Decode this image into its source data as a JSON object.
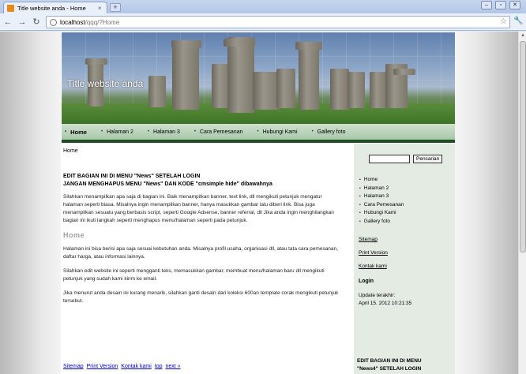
{
  "browser": {
    "tab_title": "Title website anda - Home",
    "tab_close": "×",
    "new_tab": "+",
    "url_host": "localhost",
    "url_path": "/qqq/?Home",
    "window_controls": [
      "–",
      "▫",
      "✕"
    ]
  },
  "site": {
    "title": "Title website anda",
    "nav": [
      "Home",
      "Halaman 2",
      "Halaman 3",
      "Cara Pemesanan",
      "Hubungi Kami",
      "Gallery foto"
    ]
  },
  "main": {
    "breadcrumb": "Home",
    "notice_line1": "EDIT BAGIAN INI DI MENU \"News\" SETELAH LOGIN",
    "notice_line2": "JANGAN MENGHAPUS MENU \"News\" DAN KODE \"cmsimple hide\" dibawahnya",
    "para1": "Silahkan menampilkan apa saja di bagian ini. Baik menampilkan banner, text link, dll mengikuti petunjuk mengatur halaman seperti biasa. Misalnya ingin menampilkan banner, hanya masukkan gambar lalu diberi link. Bisa juga menampilkan sesuatu yang berbasis script, seperti Google Adsense, banner referral, dll Jika anda ingin menghilangkan bagian ini ikuti langkah seperti menghapus menu/halaman seperti pada petunjuk.",
    "home_heading": "Home",
    "para2": "Halaman ini bisa berisi apa saja sesuai kebutuhan anda. Misalnya profil usaha, organisasi dll, atau tata cara pemesanan, daftar harga, atau informasi lainnya.",
    "para3": "Silahkan edit website ini seperti mengganti teks, memasukkan gambar, membuat menu/halaman baru dll mengikuti petunjuk yang sudah kami kirim ke email.",
    "para4": "Jika menurut anda desain ini kurang menarik, silahkan ganti desain dari koleksi 600an template corak mengikuti petunjuk tersebut.",
    "footer_links": [
      "Sitemap",
      "Print Version",
      "Kontak kami",
      "top",
      "next »"
    ]
  },
  "sidebar": {
    "search_button": "Pencarian",
    "search_value": "",
    "menu": [
      "Home",
      "Halaman 2",
      "Halaman 3",
      "Cara Pemesanan",
      "Hubungi Kami",
      "Gallery foto"
    ],
    "links": [
      "Sitemap",
      "Print Version",
      "Kontak kami"
    ],
    "login_heading": "Login",
    "update_label": "Update terakhir:",
    "update_value": "April 15. 2012 10:21:35",
    "bottom_line1": "EDIT BAGIAN INI DI MENU",
    "bottom_line2": "\"News4\" SETELAH LOGIN"
  },
  "icons": {
    "back": "back-arrow-icon",
    "forward": "forward-arrow-icon",
    "reload": "reload-icon",
    "star": "bookmark-star-icon",
    "wrench": "wrench-icon"
  }
}
